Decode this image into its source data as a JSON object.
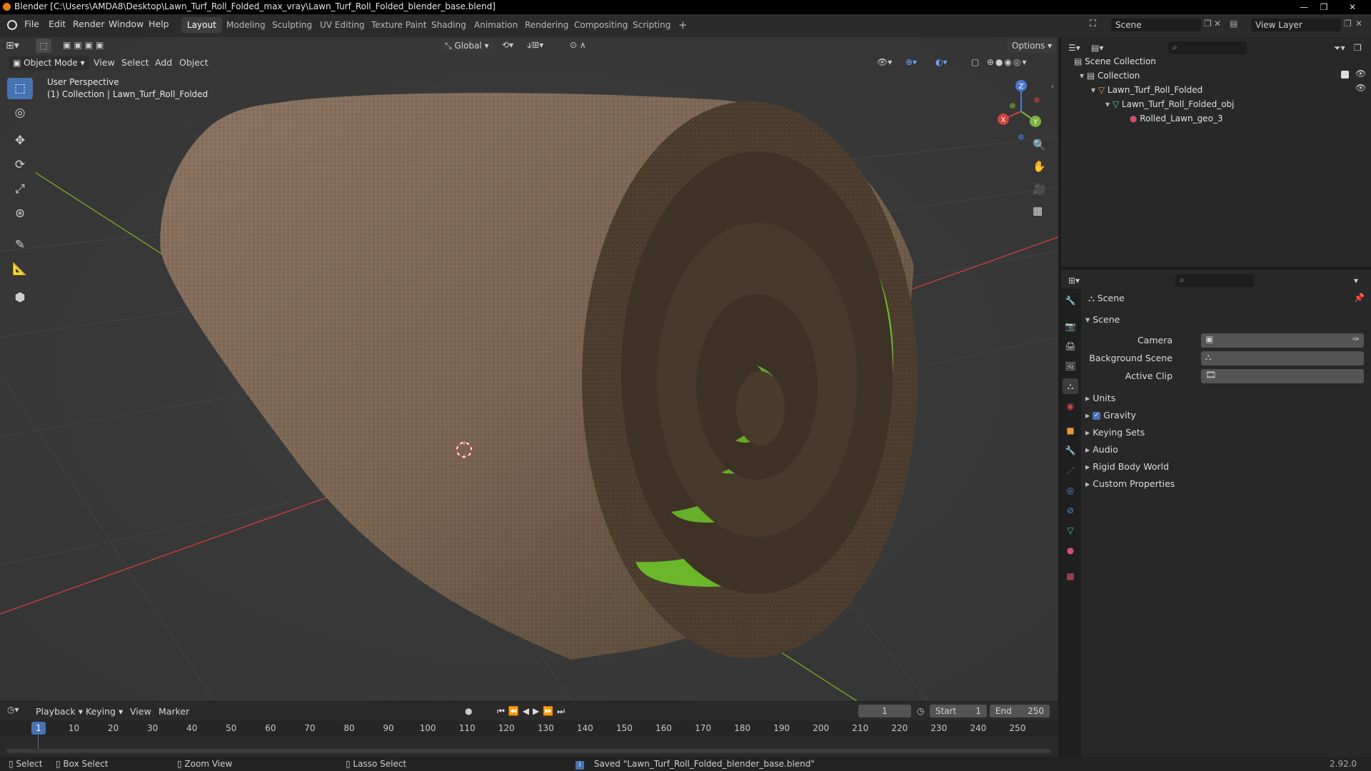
{
  "window": {
    "title": "Blender [C:\\Users\\AMDA8\\Desktop\\Lawn_Turf_Roll_Folded_max_vray\\Lawn_Turf_Roll_Folded_blender_base.blend]",
    "min": "—",
    "max": "❐",
    "close": "✕"
  },
  "menu": [
    "File",
    "Edit",
    "Render",
    "Window",
    "Help"
  ],
  "workspaces": [
    "Layout",
    "Modeling",
    "Sculpting",
    "UV Editing",
    "Texture Paint",
    "Shading",
    "Animation",
    "Rendering",
    "Compositing",
    "Scripting"
  ],
  "workspace_add": "+",
  "scene_selector": "Scene",
  "view_layer": "View Layer",
  "viewport": {
    "mode": "Object Mode",
    "header_menu": [
      "View",
      "Select",
      "Add",
      "Object"
    ],
    "transform_orientation": "Global",
    "options": "Options",
    "overlay_title": "User Perspective",
    "overlay_collection": "(1) Collection | Lawn_Turf_Roll_Folded",
    "gizmo": {
      "x": "X",
      "y": "Y",
      "z": "Z"
    }
  },
  "outliner": {
    "items": [
      {
        "label": "Scene Collection",
        "icon": "scene-collection-icon"
      },
      {
        "label": "Collection",
        "icon": "collection-icon"
      },
      {
        "label": "Lawn_Turf_Roll_Folded",
        "icon": "object-icon"
      },
      {
        "label": "Lawn_Turf_Roll_Folded_obj",
        "icon": "mesh-icon"
      },
      {
        "label": "Rolled_Lawn_geo_3",
        "icon": "material-icon"
      }
    ]
  },
  "properties": {
    "context": "Scene",
    "panel": "Scene",
    "fields": [
      {
        "label": "Camera"
      },
      {
        "label": "Background Scene"
      },
      {
        "label": "Active Clip"
      }
    ],
    "sections": [
      "Units",
      "Gravity",
      "Keying Sets",
      "Audio",
      "Rigid Body World",
      "Custom Properties"
    ]
  },
  "timeline": {
    "menus": [
      "Playback",
      "Keying",
      "View",
      "Marker"
    ],
    "current_frame": "1",
    "start_label": "Start",
    "start": "1",
    "end_label": "End",
    "end": "250",
    "ticks": [
      "1",
      "10",
      "20",
      "30",
      "40",
      "50",
      "60",
      "70",
      "80",
      "90",
      "100",
      "110",
      "120",
      "130",
      "140",
      "150",
      "160",
      "170",
      "180",
      "190",
      "200",
      "210",
      "220",
      "230",
      "240",
      "250"
    ]
  },
  "status": {
    "select": "Select",
    "box_select": "Box Select",
    "zoom_view": "Zoom View",
    "lasso_select": "Lasso Select",
    "message": "Saved \"Lawn_Turf_Roll_Folded_blender_base.blend\"",
    "version": "2.92.0"
  },
  "colors": {
    "accent": "#4772b3",
    "grid_x": "#b83c3c",
    "grid_y": "#7aa42e",
    "turf": "#7a6550",
    "grass": "#6fc42a"
  }
}
